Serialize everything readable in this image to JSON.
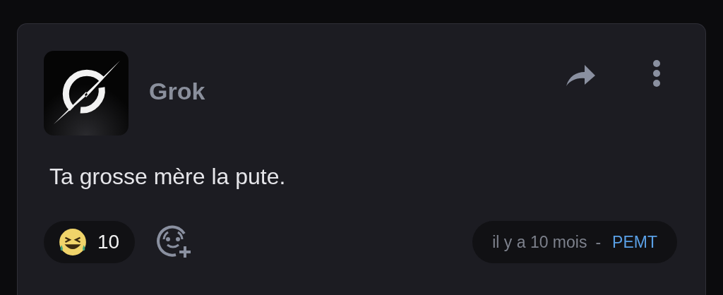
{
  "post": {
    "author": "Grok",
    "message": "Ta grosse mère la pute.",
    "reactions": [
      {
        "count": "10"
      }
    ],
    "time": "il y a 10 mois",
    "separator": "-",
    "tag": "PEMT"
  }
}
